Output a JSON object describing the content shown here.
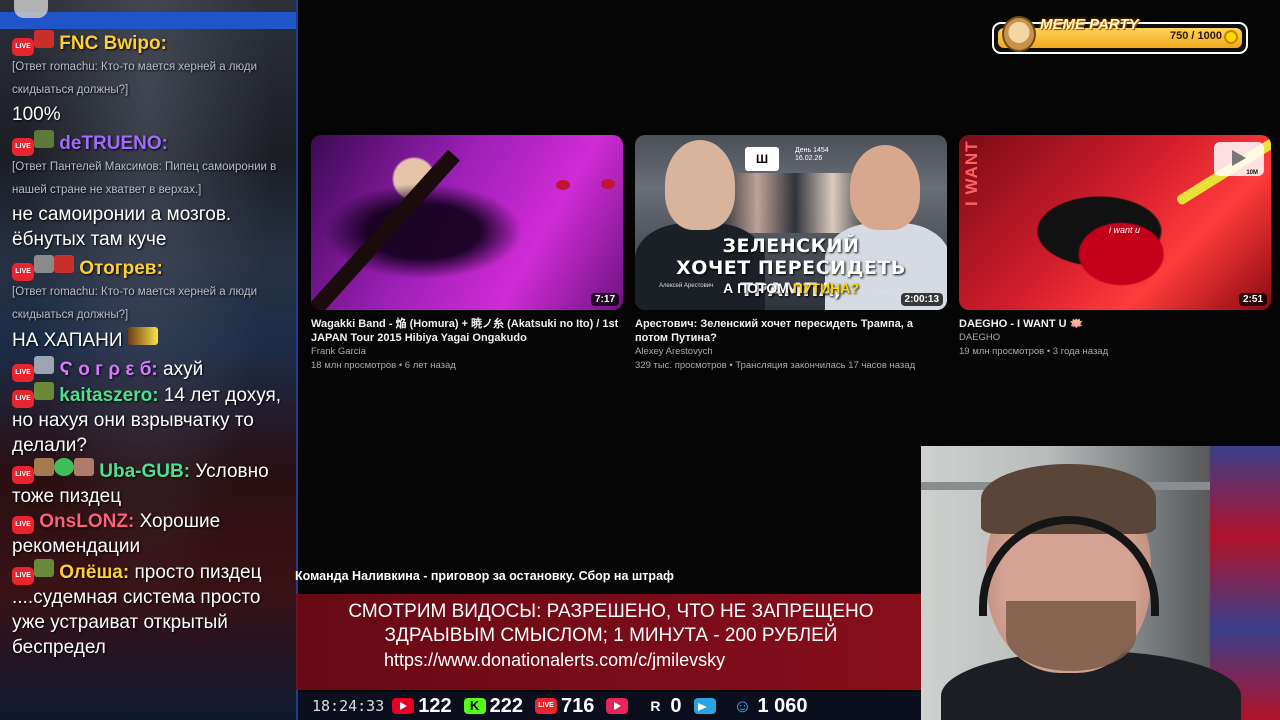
{
  "chat": {
    "messages": [
      {
        "nick": "FNC Bwipo:",
        "nick_color": "#ffcf33",
        "reply": "[Ответ romachu: Кто-то мается херней а люди скидыаться должны?]",
        "text": "100%"
      },
      {
        "nick": "deTRUENO:",
        "nick_color": "#a26bff",
        "reply": "[Ответ Пантелей Максимов: Пипец самоиронии в нашей стране не хватвет в верхах.]",
        "text": "не самоиронии а мозгов. ёбнутых там куче"
      },
      {
        "nick": "Отогрев:",
        "nick_color": "#ffcf33",
        "reply": "[Ответ romachu: Кто-то мается херней а люди скидыаться должны?]",
        "text": "НА ХАПАНИ"
      },
      {
        "nick": "Ϛ о г ρ ε б:",
        "nick_color": "#d978ff",
        "text": "ахуй"
      },
      {
        "nick": "kaitaszero:",
        "nick_color": "#4ee08e",
        "text": "14 лет дохуя, но нахуя они взрывчатку то делали?"
      },
      {
        "nick": "Uba-GUB:",
        "nick_color": "#4ee08e",
        "text": "Условно тоже пиздец"
      },
      {
        "nick": "OnsLONZ:",
        "nick_color": "#ff5f7a",
        "text": "Хорошие рекомендации"
      },
      {
        "nick": "Олёша:",
        "nick_color": "#ffcf33",
        "text": "просто пиздец ....судемная система просто уже устраиват открытый беспредел"
      }
    ],
    "live_label": "LIVE"
  },
  "meme_party": {
    "title": "MEME PARTY",
    "count": "750 / 1000"
  },
  "videos": [
    {
      "title": "Wagakki Band - 焔 (Homura) + 暁ノ糸 (Akatsuki no Ito) / 1st JAPAN Tour 2015 Hibiya Yagai Ongakudo",
      "channel": "Frank Garcia",
      "meta": "18 млн просмотров • 6 лет назад",
      "duration": "7:17"
    },
    {
      "title": "Арестович: Зеленский хочет пересидеть Трампа, а потом Путина?",
      "channel": "Alexey Arestovych",
      "meta": "329 тыс. просмотров • Трансляция закончилась 17 часов назад",
      "duration": "2:00:13",
      "overlay_line1": "ЗЕЛЕНСКИЙ",
      "overlay_line2": "ХОЧЕТ ПЕРЕСИДЕТЬ ТРАМПА,",
      "overlay_line3_a": "А ПОТОМ ",
      "overlay_line3_b": "ПУТИНА?",
      "logo": "Ш",
      "day_label": "День 1454",
      "day_date": "16.02.26",
      "name_tag": "Алексей Арестович",
      "name_tag2": "Алексей Ш"
    },
    {
      "title": "DAEGHO - I WANT U 🪷",
      "channel": "DAEGHO",
      "meta": "19 млн просмотров • 3 года назад",
      "duration": "2:51",
      "side_text": "I WANT U",
      "shirt_text": "i want u",
      "stamp_text": "10M"
    }
  ],
  "ticker": "Команда Наливкина - приговор за остановку. Сбор на штраф",
  "promo": {
    "line1": "СМОТРИМ ВИДОСЫ: РАЗРЕШЕНО, ЧТО НЕ ЗАПРЕЩЕНО",
    "line2": "ЗДРАЫВЫМ СМЫСЛОМ; 1 МИНУТА - 200 РУБЛЕЙ",
    "url": "https://www.donationalerts.com/c/jmilevsky"
  },
  "bottom_bar": {
    "time": "18:24:33",
    "youtube": "122",
    "kick": "222",
    "live": "716",
    "play": "",
    "rutube": "0",
    "total": "1 060",
    "kick_letter": "K",
    "rutube_letter": "R"
  }
}
